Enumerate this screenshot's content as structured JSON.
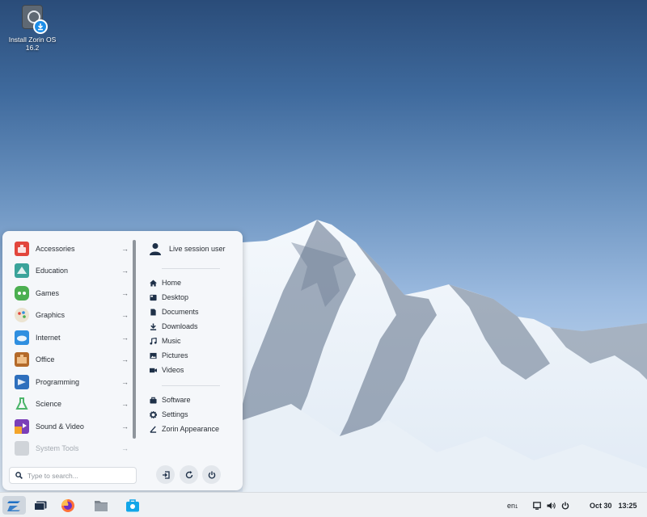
{
  "desktop": {
    "install_icon": {
      "label_line1": "Install Zorin OS",
      "label_line2": "16.2",
      "icon": "disk-download-icon"
    }
  },
  "menu": {
    "categories": [
      {
        "label": "Accessories",
        "icon": "accessories-icon",
        "color": "#e2463c"
      },
      {
        "label": "Education",
        "icon": "education-icon",
        "color": "#3aa39a"
      },
      {
        "label": "Games",
        "icon": "games-icon",
        "color": "#4caf50"
      },
      {
        "label": "Graphics",
        "icon": "graphics-icon",
        "color": "#e8e0d0"
      },
      {
        "label": "Internet",
        "icon": "internet-icon",
        "color": "#2f8fe0"
      },
      {
        "label": "Office",
        "icon": "office-icon",
        "color": "#b46a2a"
      },
      {
        "label": "Programming",
        "icon": "programming-icon",
        "color": "#2e6fbd"
      },
      {
        "label": "Science",
        "icon": "science-icon",
        "color": "#4cb56a"
      },
      {
        "label": "Sound & Video",
        "icon": "sound-video-icon",
        "color": "#7b3fb8"
      },
      {
        "label": "System Tools",
        "icon": "system-tools-icon",
        "color": "#9aa0a6"
      }
    ],
    "arrow": "→",
    "user": {
      "label": "Live session user",
      "icon": "user-icon"
    },
    "places": [
      {
        "label": "Home",
        "icon": "home-icon"
      },
      {
        "label": "Desktop",
        "icon": "desktop-icon"
      },
      {
        "label": "Documents",
        "icon": "documents-icon"
      },
      {
        "label": "Downloads",
        "icon": "downloads-icon"
      },
      {
        "label": "Music",
        "icon": "music-icon"
      },
      {
        "label": "Pictures",
        "icon": "pictures-icon"
      },
      {
        "label": "Videos",
        "icon": "videos-icon"
      }
    ],
    "system": [
      {
        "label": "Software",
        "icon": "software-icon"
      },
      {
        "label": "Settings",
        "icon": "settings-icon"
      },
      {
        "label": "Zorin Appearance",
        "icon": "appearance-icon"
      }
    ],
    "search": {
      "placeholder": "Type to search..."
    },
    "power_buttons": [
      "logout-icon",
      "restart-icon",
      "power-icon"
    ]
  },
  "taskbar": {
    "apps": [
      "zorin-menu-icon",
      "workspaces-icon",
      "firefox-icon",
      "files-icon",
      "software-store-icon"
    ],
    "keyboard_layout": "en",
    "keyboard_layout_sub": "1",
    "date": "Oct 30",
    "time": "13:25"
  },
  "colors": {
    "accent": "#1c8de8",
    "menu_bg": "#f5f7fa",
    "taskbar_bg": "#eef1f4"
  }
}
